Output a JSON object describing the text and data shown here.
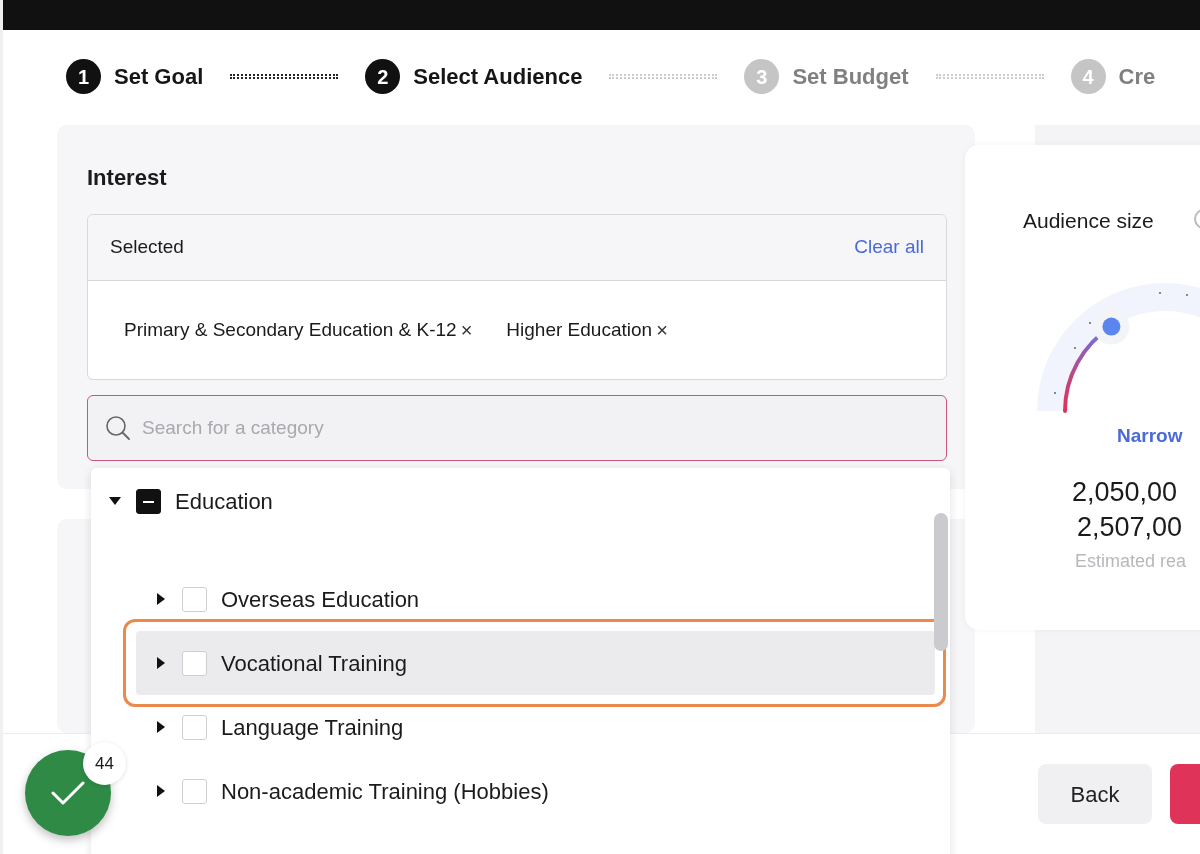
{
  "steps": [
    {
      "number": "1",
      "label": "Set Goal",
      "active": true
    },
    {
      "number": "2",
      "label": "Select Audience",
      "active": true
    },
    {
      "number": "3",
      "label": "Set Budget",
      "active": false
    },
    {
      "number": "4",
      "label": "Cre",
      "active": false
    }
  ],
  "interest": {
    "title": "Interest",
    "selected_label": "Selected",
    "clear_label": "Clear all",
    "chips": [
      {
        "label": "Primary & Secondary Education & K-12",
        "remove": "×"
      },
      {
        "label": "Higher Education",
        "remove": "×"
      }
    ],
    "search": {
      "placeholder": "Search for a category"
    }
  },
  "tree": {
    "label": "Education",
    "expanded": true,
    "indeterminate": true,
    "children": [
      {
        "label": "Overseas Education",
        "expanded": false,
        "checked": false,
        "selected": false,
        "annotated": false
      },
      {
        "label": "Vocational Training",
        "expanded": false,
        "checked": false,
        "selected": true,
        "annotated": true
      },
      {
        "label": "Language Training",
        "expanded": false,
        "checked": false,
        "selected": false,
        "annotated": false
      },
      {
        "label": "Non-academic Training (Hobbies)",
        "expanded": false,
        "checked": false,
        "selected": false,
        "annotated": false
      }
    ]
  },
  "audience": {
    "title": "Audience size",
    "rating": "Narrow",
    "range_low": "2,050,00",
    "range_high": "2,507,00",
    "caption": "Estimated rea"
  },
  "footer": {
    "buttons": [
      {
        "label": "Back",
        "kind": "secondary"
      },
      {
        "kind": "primary"
      }
    ]
  },
  "progress_badge": {
    "count": "44"
  }
}
